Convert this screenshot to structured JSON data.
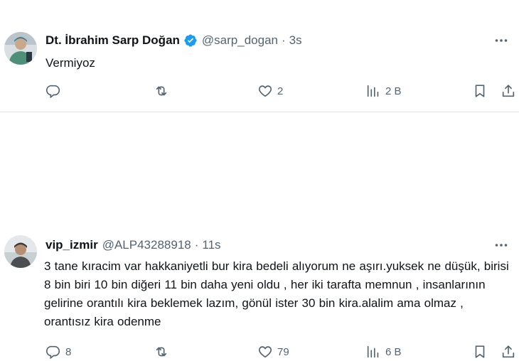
{
  "tweets": [
    {
      "name": "Dt. İbrahim Sarp Doğan",
      "verified": true,
      "handle": "@sarp_dogan",
      "separator": "·",
      "time": "3s",
      "text": "Vermiyoz",
      "stats": {
        "replies": "",
        "retweets": "",
        "likes": "2",
        "views": "2 B"
      },
      "icons": [
        "reply-icon",
        "retweet-icon",
        "heart-icon",
        "views-icon",
        "bookmark-icon",
        "share-icon"
      ]
    },
    {
      "name": "vip_izmir",
      "verified": false,
      "handle": "@ALP43288918",
      "separator": "·",
      "time": "11s",
      "text": "3 tane kıracim var hakkaniyetli bur kira bedeli alıyorum ne aşırı.yuksek ne düşük, birisi 8 bin biri 10 bin diğeri 11 bin daha yeni oldu , her iki tarafta memnun , insanlarının gelirine orantılı kira beklemek lazım, gönül ister 30 bin kira.alalim ama olmaz , orantısız kira odenme",
      "stats": {
        "replies": "8",
        "retweets": "",
        "likes": "79",
        "views": "6 B"
      },
      "icons": [
        "reply-icon",
        "retweet-icon",
        "heart-icon",
        "views-icon",
        "bookmark-icon",
        "share-icon"
      ]
    }
  ],
  "colors": {
    "text": "#0f1419",
    "secondary": "#536471",
    "verified": "#1d9bf0",
    "divider": "#e1e6ea"
  }
}
